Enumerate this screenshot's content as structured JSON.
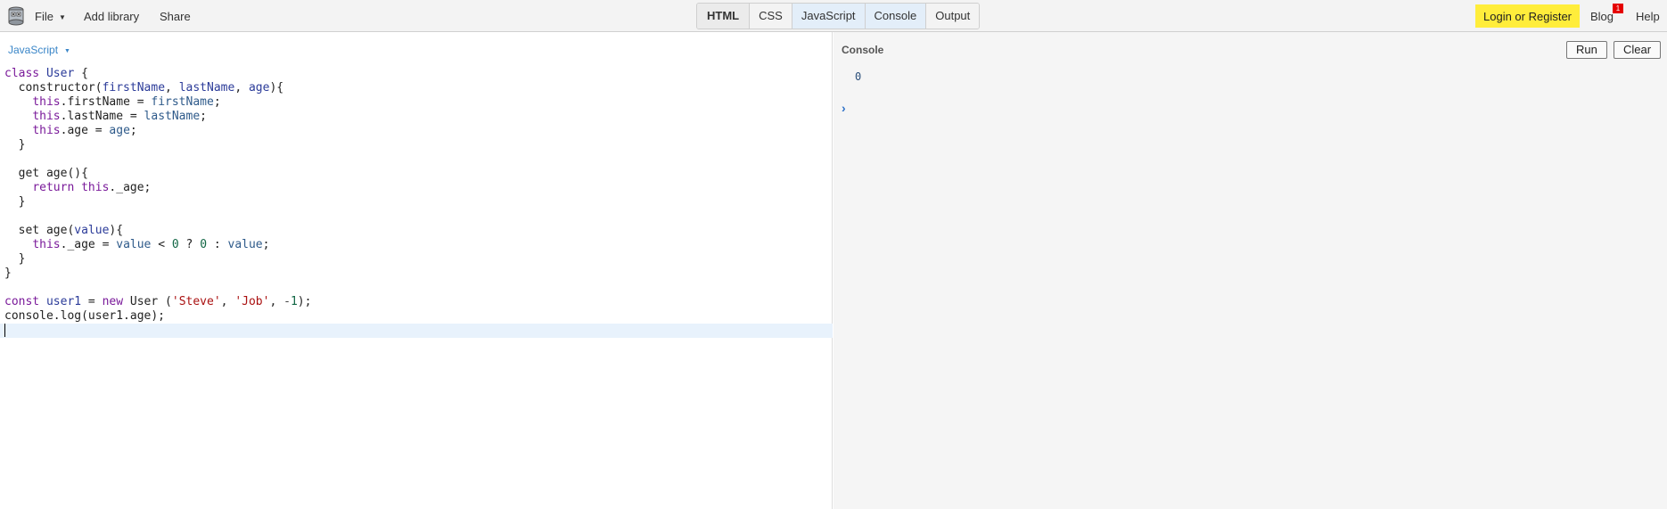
{
  "toolbar": {
    "menu": {
      "file": "File",
      "add_library": "Add library",
      "share": "Share"
    },
    "tabs": [
      {
        "label": "HTML",
        "bold": true,
        "active": false
      },
      {
        "label": "CSS",
        "bold": false,
        "active": false
      },
      {
        "label": "JavaScript",
        "bold": false,
        "active": true
      },
      {
        "label": "Console",
        "bold": false,
        "active": true
      },
      {
        "label": "Output",
        "bold": false,
        "active": false
      }
    ],
    "login": "Login or Register",
    "blog": "Blog",
    "blog_badge": "1",
    "help": "Help",
    "colors": {
      "login_bg": "#ffed3b",
      "badge_bg": "#e50000",
      "tab_active_bg": "#e3eef9"
    }
  },
  "editor": {
    "language": "JavaScript",
    "code_lines": [
      [
        [
          "kw",
          "class"
        ],
        [
          "t",
          " "
        ],
        [
          "def",
          "User"
        ],
        [
          "t",
          " {"
        ]
      ],
      [
        [
          "t",
          "  "
        ],
        [
          "t",
          "constructor"
        ],
        [
          "t",
          "("
        ],
        [
          "def",
          "firstName"
        ],
        [
          "t",
          ", "
        ],
        [
          "def",
          "lastName"
        ],
        [
          "t",
          ", "
        ],
        [
          "def",
          "age"
        ],
        [
          "t",
          "){"
        ]
      ],
      [
        [
          "t",
          "    "
        ],
        [
          "kw",
          "this"
        ],
        [
          "t",
          ".firstName = "
        ],
        [
          "var",
          "firstName"
        ],
        [
          "t",
          ";"
        ]
      ],
      [
        [
          "t",
          "    "
        ],
        [
          "kw",
          "this"
        ],
        [
          "t",
          ".lastName = "
        ],
        [
          "var",
          "lastName"
        ],
        [
          "t",
          ";"
        ]
      ],
      [
        [
          "t",
          "    "
        ],
        [
          "kw",
          "this"
        ],
        [
          "t",
          ".age = "
        ],
        [
          "var",
          "age"
        ],
        [
          "t",
          ";"
        ]
      ],
      [
        [
          "t",
          "  }"
        ]
      ],
      [
        [
          "t",
          ""
        ]
      ],
      [
        [
          "t",
          "  get age(){"
        ]
      ],
      [
        [
          "t",
          "    "
        ],
        [
          "kw",
          "return"
        ],
        [
          "t",
          " "
        ],
        [
          "kw",
          "this"
        ],
        [
          "t",
          "._age;"
        ]
      ],
      [
        [
          "t",
          "  }"
        ]
      ],
      [
        [
          "t",
          ""
        ]
      ],
      [
        [
          "t",
          "  set age("
        ],
        [
          "def",
          "value"
        ],
        [
          "t",
          "){"
        ]
      ],
      [
        [
          "t",
          "    "
        ],
        [
          "kw",
          "this"
        ],
        [
          "t",
          "._age = "
        ],
        [
          "var",
          "value"
        ],
        [
          "t",
          " < "
        ],
        [
          "num",
          "0"
        ],
        [
          "t",
          " ? "
        ],
        [
          "num",
          "0"
        ],
        [
          "t",
          " : "
        ],
        [
          "var",
          "value"
        ],
        [
          "t",
          ";"
        ]
      ],
      [
        [
          "t",
          "  }"
        ]
      ],
      [
        [
          "t",
          "}"
        ]
      ],
      [
        [
          "t",
          ""
        ]
      ],
      [
        [
          "kw",
          "const"
        ],
        [
          "t",
          " "
        ],
        [
          "def",
          "user1"
        ],
        [
          "t",
          " = "
        ],
        [
          "kw",
          "new"
        ],
        [
          "t",
          " User ("
        ],
        [
          "str",
          "'Steve'"
        ],
        [
          "t",
          ", "
        ],
        [
          "str",
          "'Job'"
        ],
        [
          "t",
          ", "
        ],
        [
          "op",
          "-"
        ],
        [
          "num",
          "1"
        ],
        [
          "t",
          ");"
        ]
      ],
      [
        [
          "t",
          "console.log(user1.age);"
        ]
      ],
      [
        [
          "cursor",
          ""
        ]
      ]
    ]
  },
  "console": {
    "title": "Console",
    "run": "Run",
    "clear": "Clear",
    "output": "0",
    "prompt": "›"
  }
}
